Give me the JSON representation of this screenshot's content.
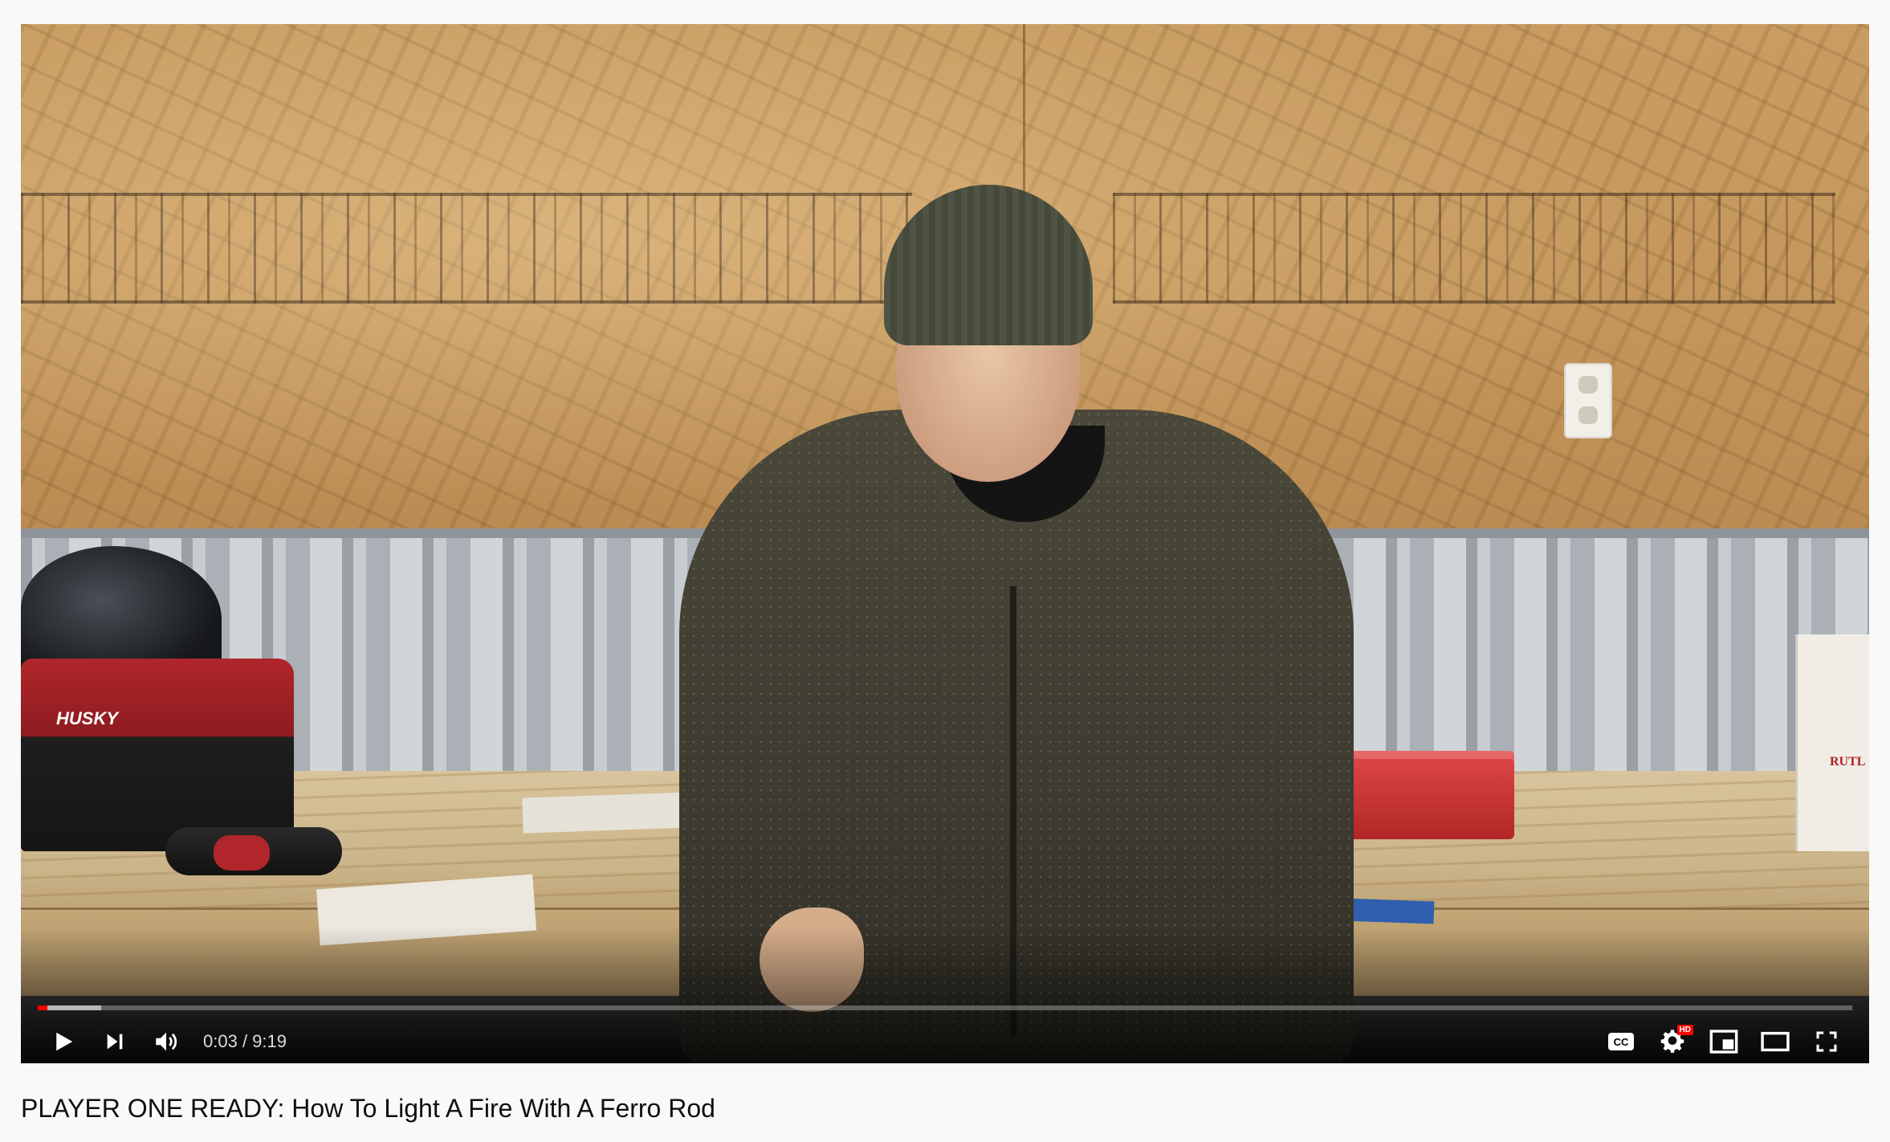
{
  "video": {
    "title": "PLAYER ONE READY: How To Light A Fire With A Ferro Rod",
    "current_time": "0:03",
    "duration": "9:19",
    "time_separator": " / ",
    "played_fraction": 0.0055,
    "loaded_fraction": 0.035,
    "scene_bag_label": "HUSKY",
    "scene_box_label": "RUTL"
  },
  "controls": {
    "play": "play-icon",
    "next": "next-icon",
    "volume": "volume-icon",
    "captions": "captions-icon",
    "captions_text": "CC",
    "settings": "settings-icon",
    "hd_badge": "HD",
    "miniplayer": "miniplayer-icon",
    "theater": "theater-icon",
    "fullscreen": "fullscreen-icon"
  },
  "colors": {
    "progress_played": "#ff0000",
    "hd_badge": "#ff0000",
    "page_background": "#f9f9f9"
  }
}
